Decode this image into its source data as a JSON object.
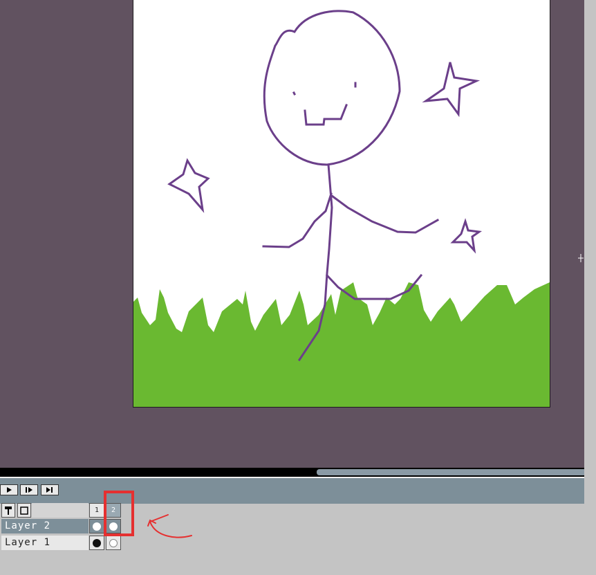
{
  "timeline": {
    "frames": [
      "1",
      "2"
    ],
    "layers": [
      {
        "name": "Layer 2",
        "selected": true,
        "frame1": "white-dot",
        "frame2": "white-dot"
      },
      {
        "name": "Layer 1",
        "selected": false,
        "frame1": "black-dot",
        "frame2": "white-dot"
      }
    ],
    "playback_icons": [
      "play-icon",
      "step-forward-icon",
      "jump-to-end-icon"
    ],
    "tool_icons": [
      "pin-icon",
      "onion-skin-icon"
    ],
    "highlighted_frame": "2"
  },
  "colors": {
    "workspace": "#615260",
    "canvas": "#ffffff",
    "grass": "#6ab931",
    "stroke": "#6b3f8a",
    "controlbar": "#7d8f99",
    "annotation": "#e53030",
    "layer_selected": "#7d8f99",
    "layer_default": "#e8e8e8"
  }
}
